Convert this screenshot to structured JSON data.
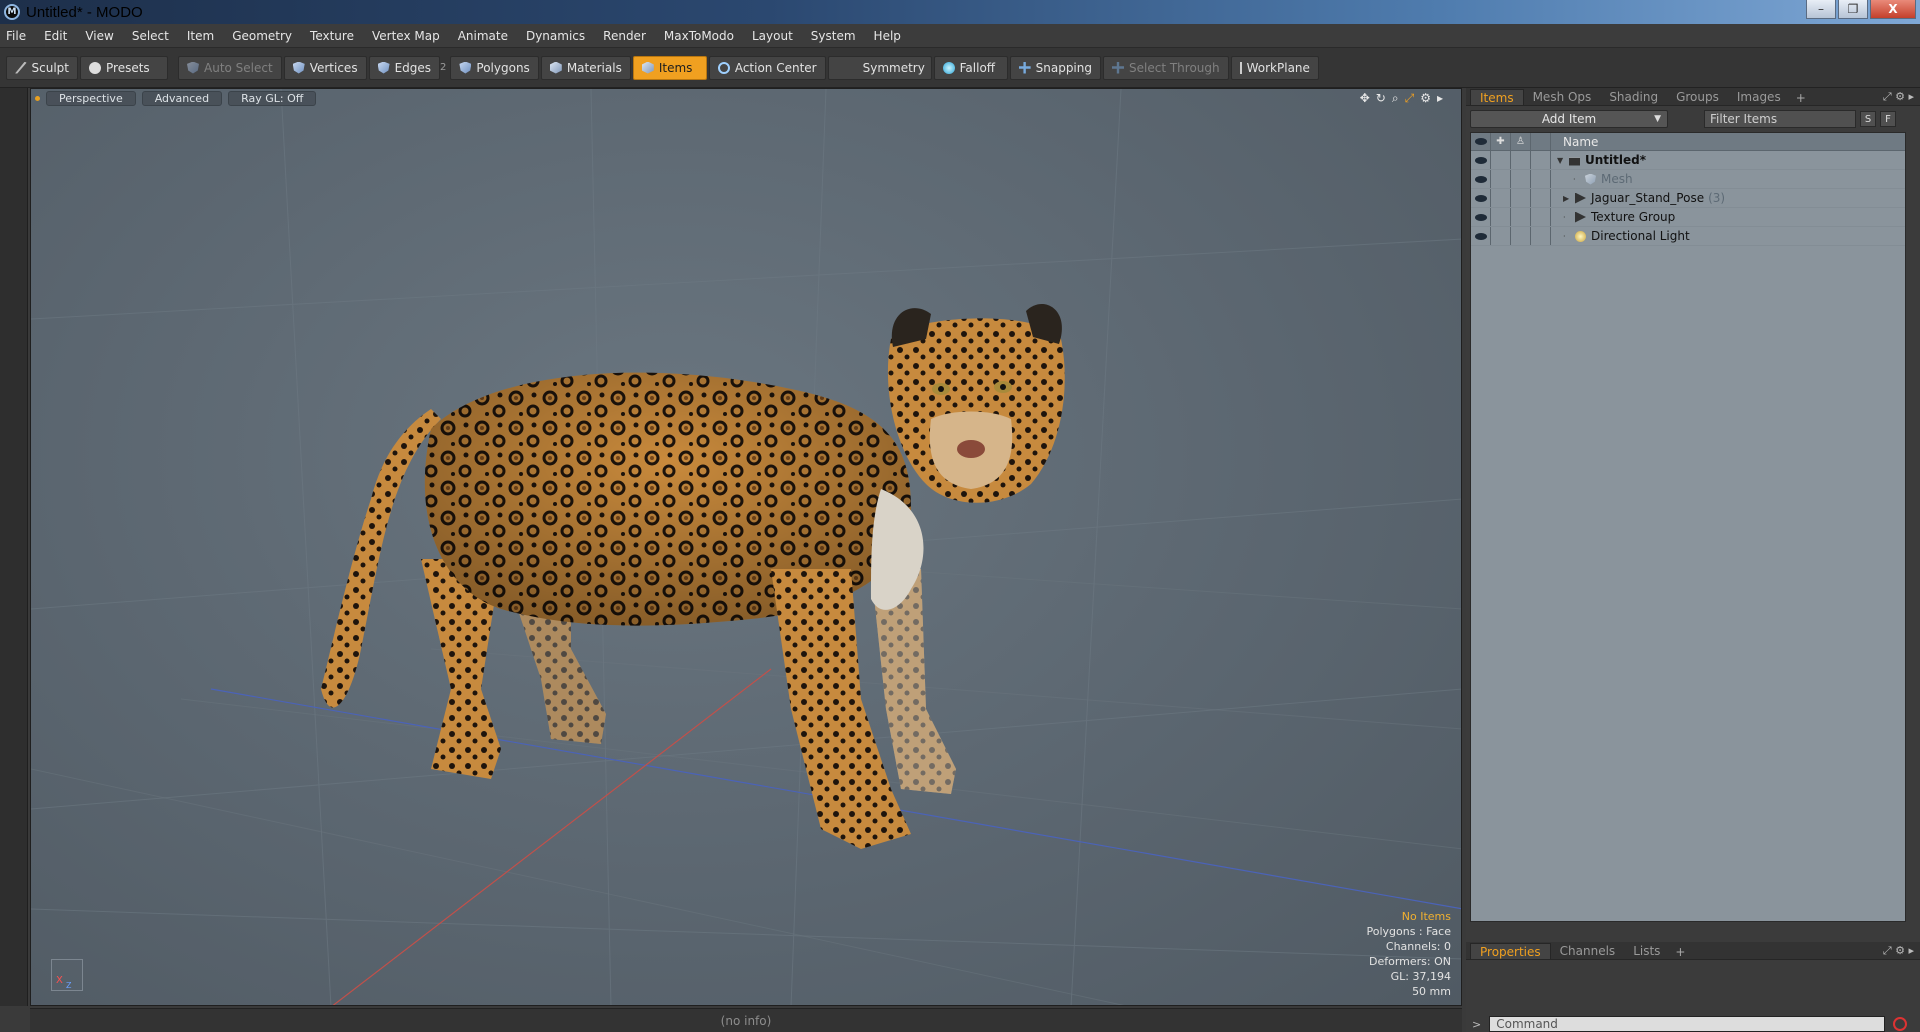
{
  "window": {
    "title": "Untitled* - MODO",
    "controls": [
      "–",
      "❐",
      "X"
    ]
  },
  "menu": [
    "File",
    "Edit",
    "View",
    "Select",
    "Item",
    "Geometry",
    "Texture",
    "Vertex Map",
    "Animate",
    "Dynamics",
    "Render",
    "MaxToModo",
    "Layout",
    "System",
    "Help"
  ],
  "toolbar": {
    "sculpt": "Sculpt",
    "presets": "Presets",
    "auto_select": "Auto Select",
    "vertices": "Vertices",
    "edges": "Edges",
    "edges_key": "2",
    "polygons": "Polygons",
    "materials": "Materials",
    "items": "Items",
    "action_center": "Action Center",
    "symmetry": "Symmetry",
    "falloff": "Falloff",
    "snapping": "Snapping",
    "select_through": "Select Through",
    "workplane": "WorkPlane"
  },
  "viewport": {
    "tabs": [
      "Perspective",
      "Advanced",
      "Ray GL: Off"
    ],
    "info": {
      "selection": "No Items",
      "polygons": "Polygons : Face",
      "channels": "Channels: 0",
      "deformers": "Deformers: ON",
      "gl": "GL: 37,194",
      "focal": "50 mm"
    },
    "gizmo_x": "X",
    "gizmo_z": "Z"
  },
  "status": {
    "text": "(no info)"
  },
  "items_panel": {
    "tabs": [
      "Items",
      "Mesh Ops",
      "Shading",
      "Groups",
      "Images"
    ],
    "add_item": "Add Item",
    "filter_placeholder": "Filter Items",
    "s_btn": "S",
    "f_btn": "F",
    "name_header": "Name",
    "rows": [
      {
        "label": "Untitled*",
        "count": ""
      },
      {
        "label": "Mesh",
        "count": ""
      },
      {
        "label": "Jaguar_Stand_Pose",
        "count": "(3)"
      },
      {
        "label": "Texture Group",
        "count": ""
      },
      {
        "label": "Directional Light",
        "count": ""
      }
    ]
  },
  "props_panel": {
    "tabs": [
      "Properties",
      "Channels",
      "Lists"
    ]
  },
  "command": {
    "prompt": ">",
    "placeholder": "Command"
  },
  "colors": {
    "accent": "#f0a020",
    "viewport_bg": "#5f6a73",
    "tree_bg": "#8a949c"
  }
}
